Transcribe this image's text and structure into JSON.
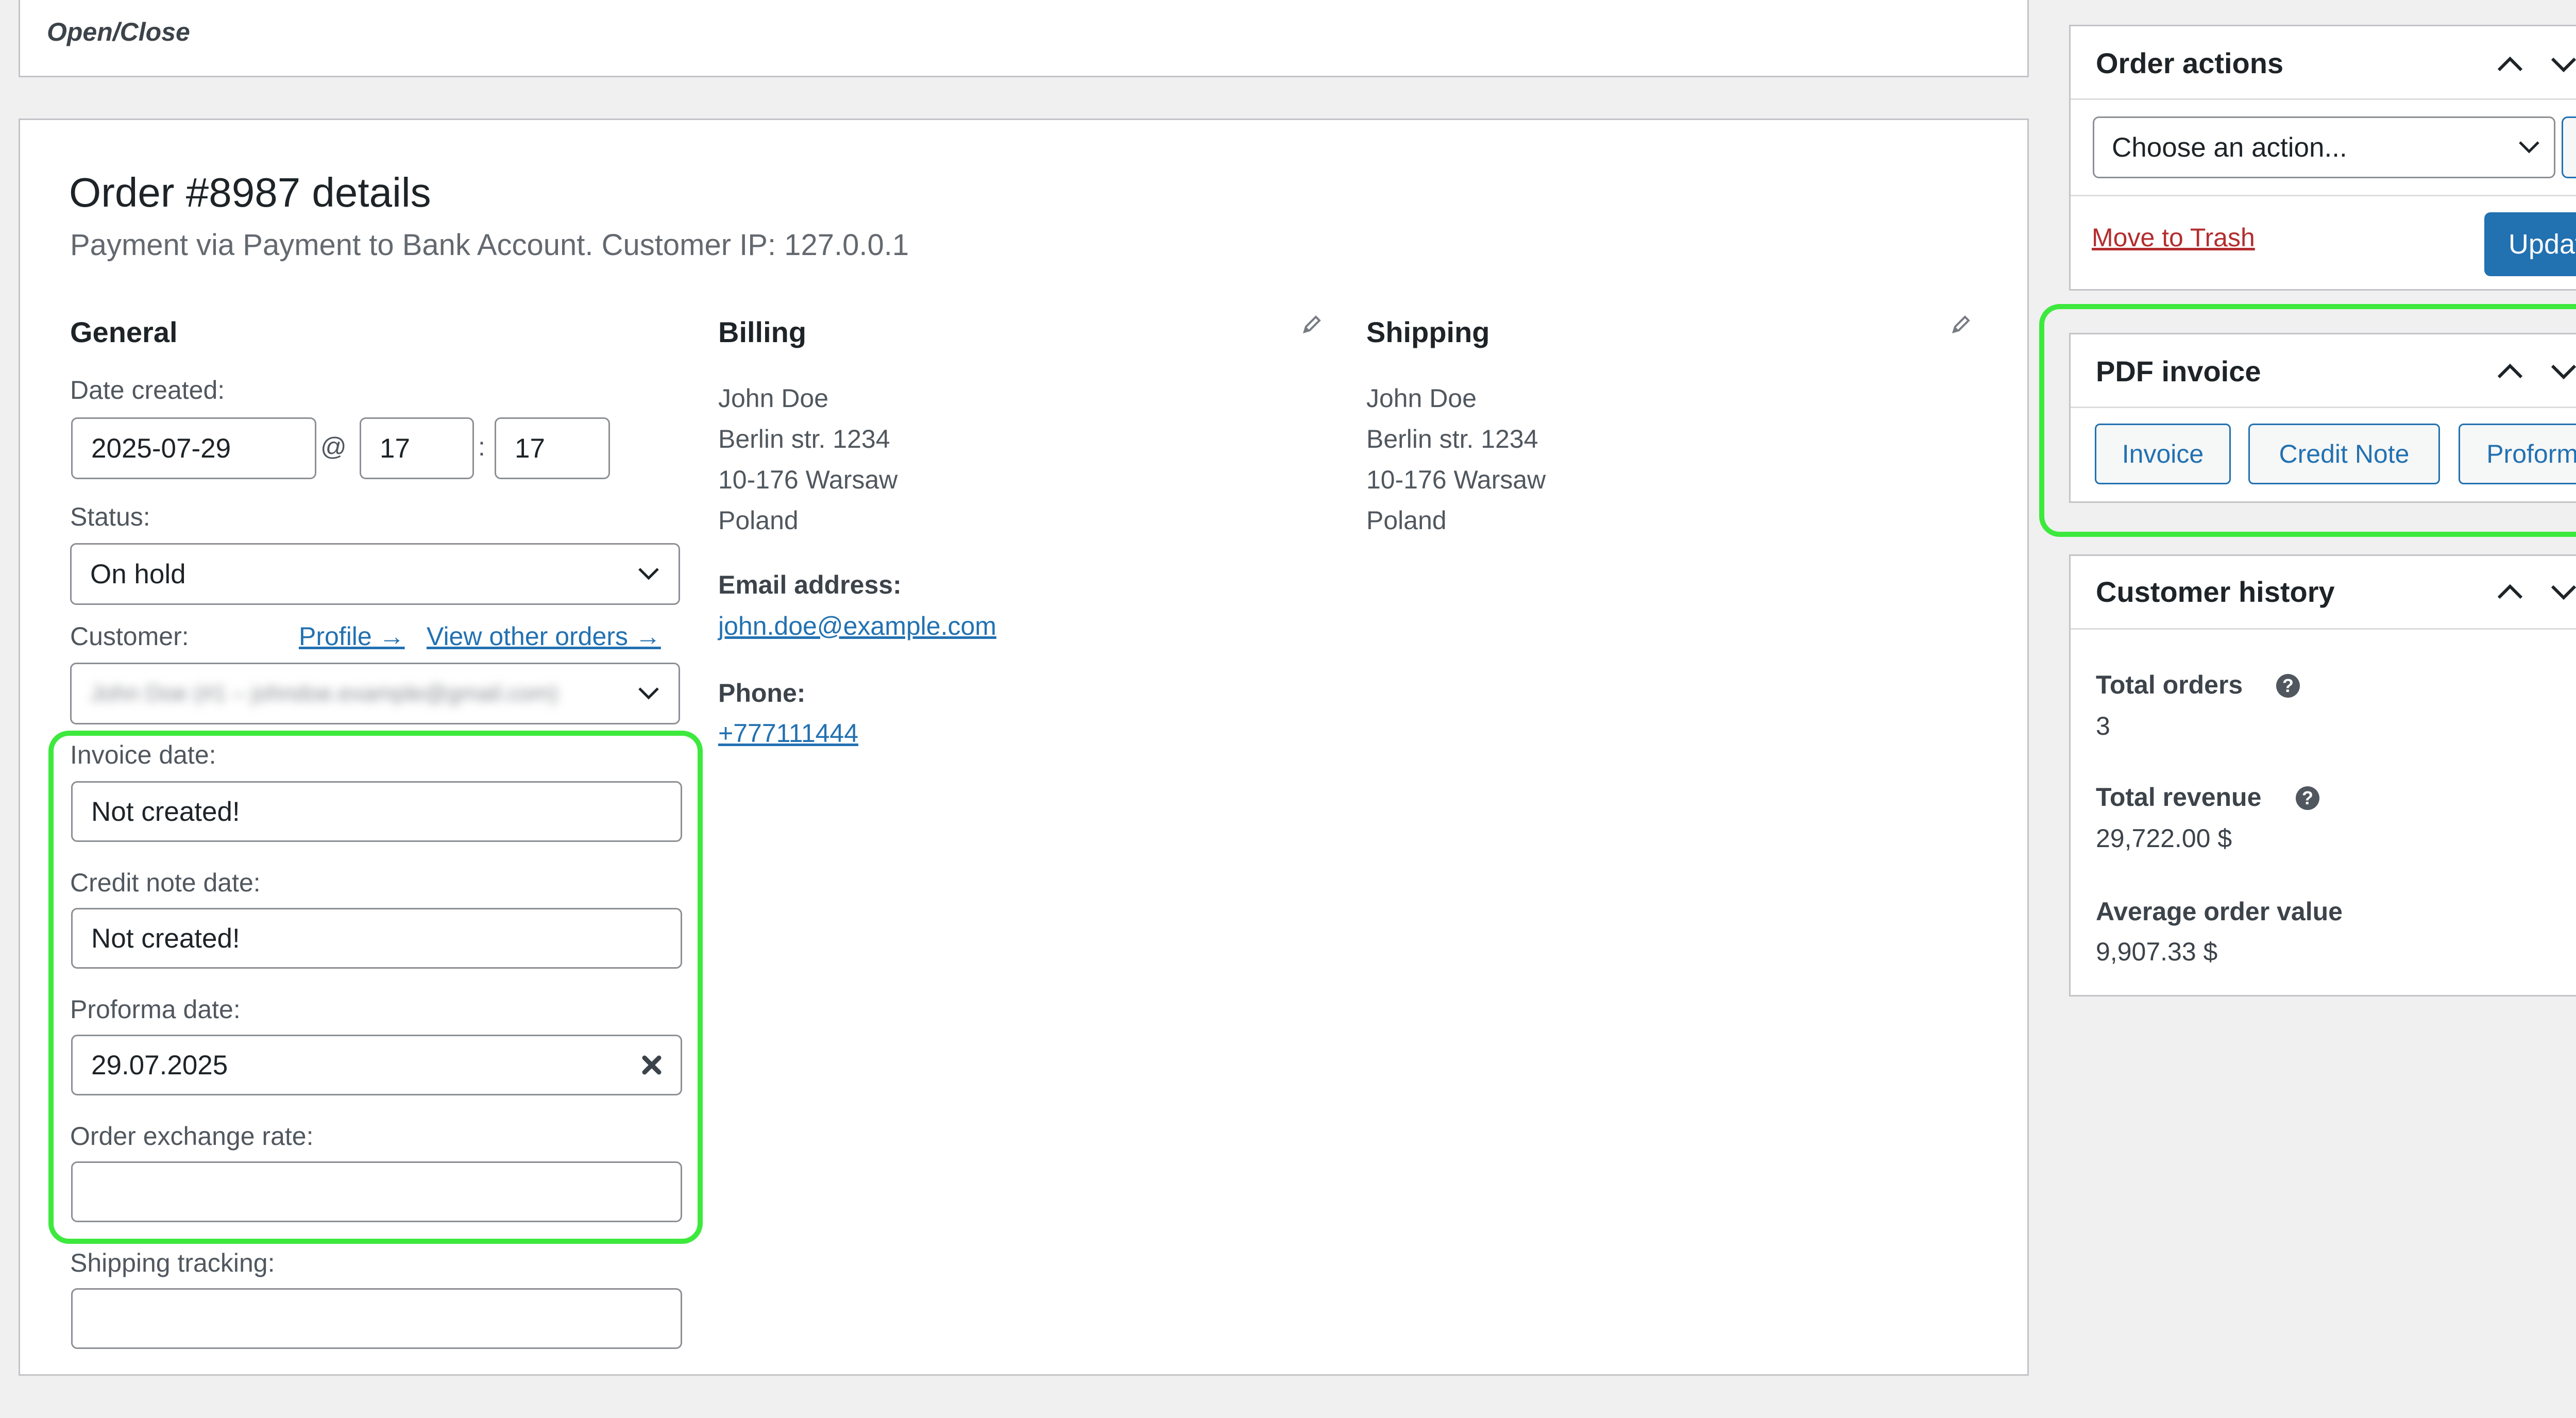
{
  "top_box": {
    "toggle_label": "Open/Close"
  },
  "order": {
    "heading": "Order #8987 details",
    "meta": "Payment via Payment to Bank Account. Customer IP: 127.0.0.1"
  },
  "general": {
    "heading": "General",
    "date_created_label": "Date created:",
    "date_value": "2025-07-29",
    "at_symbol": "@",
    "hour": "17",
    "colon": ":",
    "minute": "17",
    "status_label": "Status:",
    "status_value": "On hold",
    "customer_label": "Customer:",
    "profile_link": "Profile →",
    "view_orders_link": "View other orders →",
    "customer_value": "John Doe (#1 – johndoe.example@gmail.com)",
    "invoice_date_label": "Invoice date:",
    "invoice_date_value": "Not created!",
    "credit_note_date_label": "Credit note date:",
    "credit_note_date_value": "Not created!",
    "proforma_date_label": "Proforma date:",
    "proforma_date_value": "29.07.2025",
    "exchange_rate_label": "Order exchange rate:",
    "exchange_rate_value": "",
    "shipping_tracking_label": "Shipping tracking:",
    "shipping_tracking_value": ""
  },
  "billing": {
    "heading": "Billing",
    "name": "John Doe",
    "street": "Berlin str. 1234",
    "city": "10-176 Warsaw",
    "country": "Poland",
    "email_label": "Email address:",
    "email": "john.doe@example.com",
    "phone_label": "Phone:",
    "phone": "+777111444"
  },
  "shipping": {
    "heading": "Shipping",
    "name": "John Doe",
    "street": "Berlin str. 1234",
    "city": "10-176 Warsaw",
    "country": "Poland"
  },
  "order_actions": {
    "title": "Order actions",
    "select_value": "Choose an action...",
    "trash_link": "Move to Trash",
    "update_button": "Update"
  },
  "pdf_invoice": {
    "title": "PDF invoice",
    "buttons": [
      "Invoice",
      "Credit Note",
      "Proforma"
    ]
  },
  "customer_history": {
    "title": "Customer history",
    "total_orders_label": "Total orders",
    "total_orders_value": "3",
    "total_revenue_label": "Total revenue",
    "total_revenue_value": "29,722.00 $",
    "avg_order_label": "Average order value",
    "avg_order_value": "9,907.33 $"
  },
  "colors": {
    "accent": "#2271b1",
    "highlight": "#3de93d",
    "trash": "#b32d2e",
    "background": "#f0f0f1"
  },
  "icons": [
    "pencil-icon",
    "chevron-down-icon",
    "chevron-up-icon",
    "triangle-up-icon",
    "arrow-right-icon",
    "help-icon",
    "clear-icon"
  ]
}
